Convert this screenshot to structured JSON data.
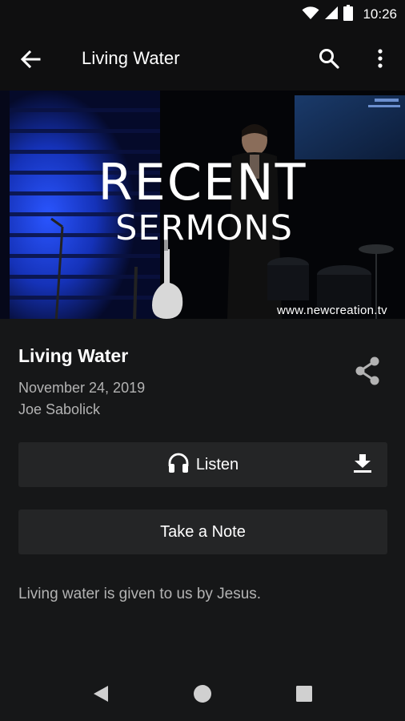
{
  "status_bar": {
    "time": "10:26",
    "icons": [
      "wifi-icon",
      "cell-signal-icon",
      "battery-icon"
    ]
  },
  "app_bar": {
    "title": "Living Water",
    "icons": [
      "arrow-left-icon",
      "search-icon",
      "more-vertical-icon"
    ]
  },
  "banner": {
    "line1": "RECENT",
    "line2": "SERMONS",
    "url": "www.newcreation.tv"
  },
  "sermon": {
    "title": "Living Water",
    "date": "November 24, 2019",
    "speaker": "Joe Sabolick",
    "description": "Living water is given to us by Jesus."
  },
  "actions": {
    "listen_label": "Listen",
    "note_label": "Take a Note",
    "icons": [
      "headphones-icon",
      "download-icon",
      "share-icon"
    ]
  },
  "colors": {
    "background": "#161718",
    "app_bar": "#0f0f10",
    "button": "#242526",
    "secondary_text": "#b3b3b3",
    "accent_blue": "#1f3fd6"
  }
}
